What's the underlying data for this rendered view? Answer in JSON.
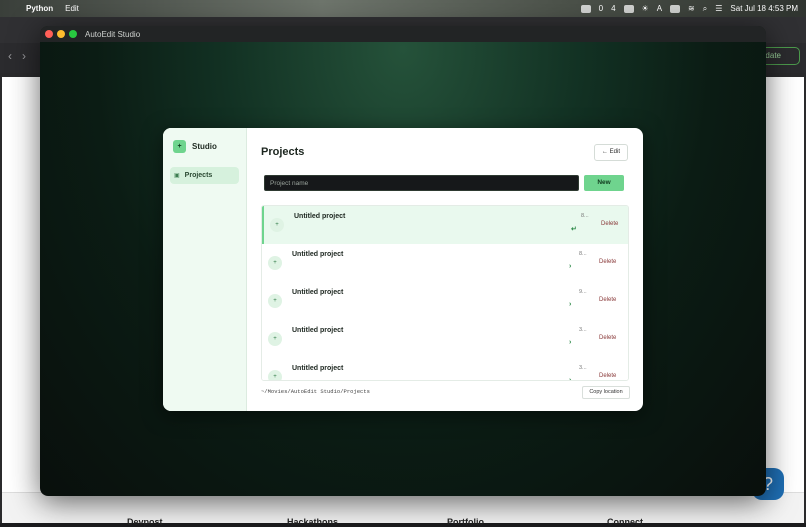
{
  "menubar": {
    "app_name": "Python",
    "menu_edit": "Edit",
    "datetime": "Sat Jul 18  4:53 PM",
    "status_items": [
      "0",
      "4",
      "A"
    ]
  },
  "browser": {
    "update_label": "Update",
    "footer_links": [
      "Devpost",
      "Hackathons",
      "Portfolio",
      "Connect"
    ],
    "help_glyph": "?"
  },
  "window": {
    "title": "AutoEdit Studio"
  },
  "sidebar": {
    "brand_label": "Studio",
    "brand_icon": "+",
    "items": [
      {
        "label": "Projects",
        "icon": "grid-icon"
      }
    ],
    "path": "~/Movies/AutoEdit Studio/Projects"
  },
  "main": {
    "title": "Projects",
    "edit_label": "← Edit",
    "input_placeholder": "Project name",
    "new_label": "New",
    "copy_location_label": "Copy location"
  },
  "projects": [
    {
      "name": "Untitled project",
      "date": "8...",
      "action_glyph": "↵",
      "delete_label": "Delete",
      "active": true
    },
    {
      "name": "Untitled project",
      "date": "8...",
      "action_glyph": "›",
      "delete_label": "Delete",
      "active": false
    },
    {
      "name": "Untitled project",
      "date": "9...",
      "action_glyph": "›",
      "delete_label": "Delete",
      "active": false
    },
    {
      "name": "Untitled project",
      "date": "3...",
      "action_glyph": "›",
      "delete_label": "Delete",
      "active": false
    },
    {
      "name": "Untitled project",
      "date": "3...",
      "action_glyph": "›",
      "delete_label": "Delete",
      "active": false
    }
  ],
  "colors": {
    "accent": "#6fd48e",
    "active_row": "#e9f9ee",
    "sidebar_bg": "#effaf2"
  }
}
